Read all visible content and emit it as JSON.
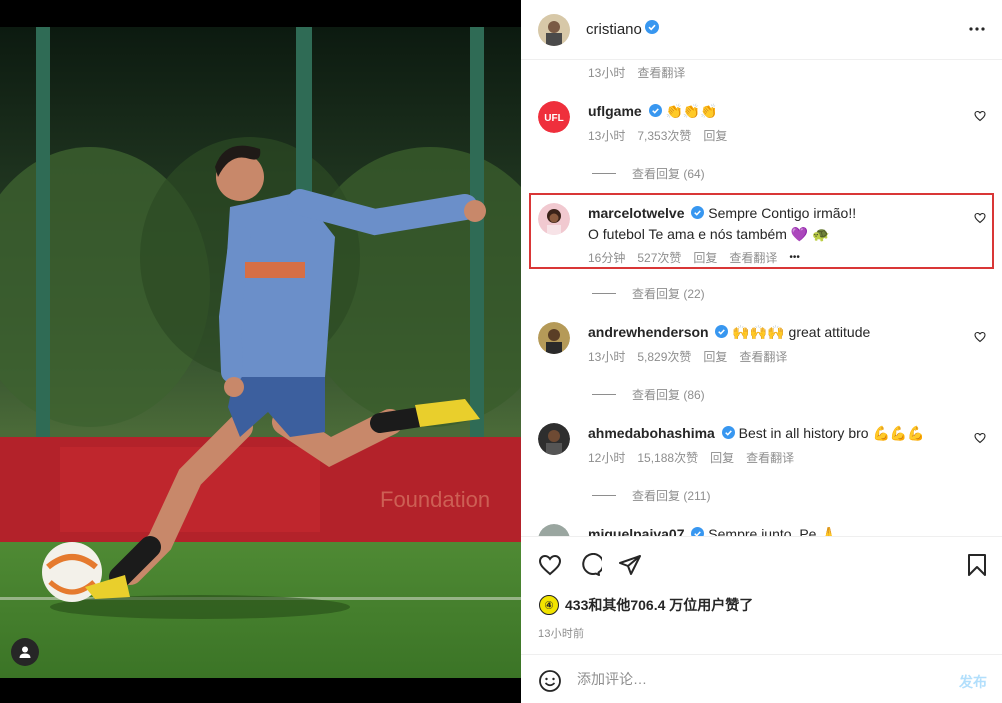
{
  "post": {
    "author": "cristiano",
    "verified": true
  },
  "comments": {
    "previous_meta": {
      "time": "13小时",
      "translate": "查看翻译"
    },
    "items": [
      {
        "username": "uflgame",
        "verified": true,
        "text": "👏👏👏",
        "time": "13小时",
        "likes": "7,353次赞",
        "reply": "回复",
        "view_replies": "查看回复 (64)",
        "avatar_icon": "ufl-logo-icon"
      },
      {
        "username": "marcelotwelve",
        "verified": true,
        "text": "Sempre Contigo irmão!!",
        "text_line2": "O futebol Te ama e nós também 💜 🐢",
        "time": "16分钟",
        "likes": "527次赞",
        "reply": "回复",
        "translate": "查看翻译",
        "more": "•••",
        "view_replies": "查看回复 (22)",
        "highlighted": true
      },
      {
        "username": "andrewhenderson",
        "verified": true,
        "text": "🙌🙌🙌 great attitude",
        "time": "13小时",
        "likes": "5,829次赞",
        "reply": "回复",
        "translate": "查看翻译",
        "view_replies": "查看回复 (86)"
      },
      {
        "username": "ahmedabohashima",
        "verified": true,
        "text": "Best in all history bro 💪💪💪",
        "time": "12小时",
        "likes": "15,188次赞",
        "reply": "回复",
        "translate": "查看翻译",
        "view_replies": "查看回复 (211)"
      },
      {
        "username": "miguelpaiva07",
        "verified": true,
        "text": "Sempre junto, Pe 🙏"
      }
    ]
  },
  "actions": {
    "likes_text": "433和其他706.4 万位用户赞了",
    "like_badge": "④",
    "time_ago": "13小时前"
  },
  "composer": {
    "placeholder": "添加评论…",
    "post_label": "发布"
  },
  "colors": {
    "verified": "#3897f0",
    "highlight": "#d93636",
    "post_button": "#b2dffc",
    "muted_text": "#8e8e8e"
  }
}
